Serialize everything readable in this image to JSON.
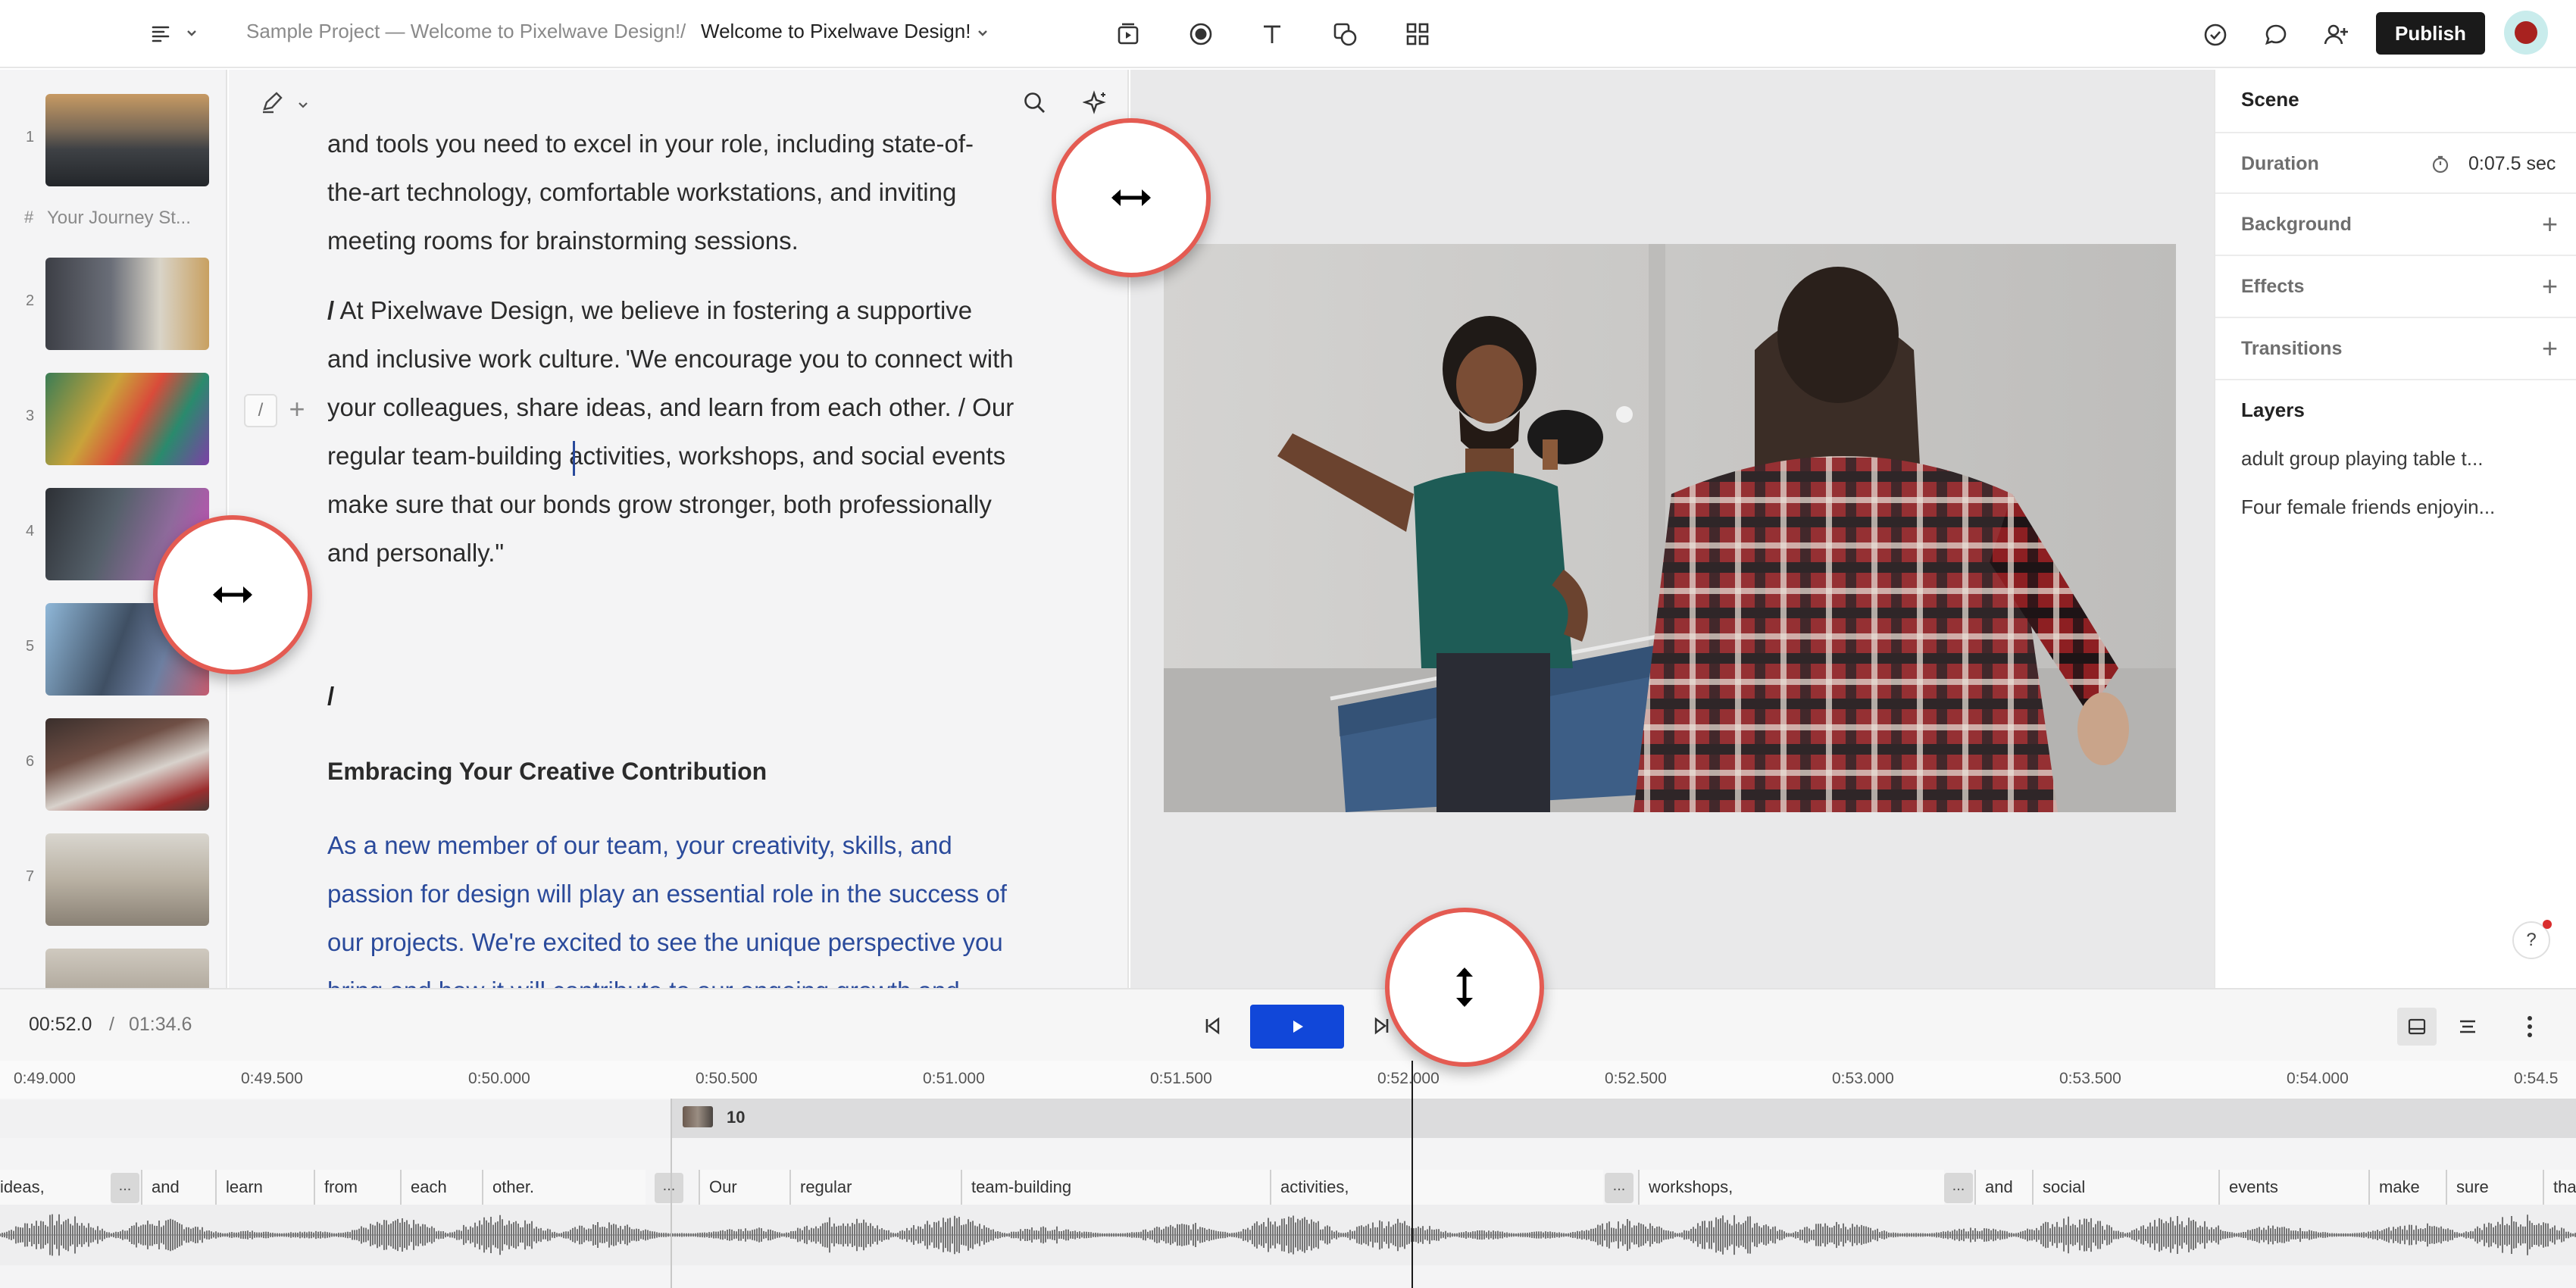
{
  "header": {
    "project": "Sample Project — Welcome to Pixelwave Design!",
    "separator": "/",
    "doc_title": "Welcome to Pixelwave Design!",
    "publish_label": "Publish",
    "icons": [
      "menu-icon",
      "chevron-down-icon",
      "preview-icon",
      "record-icon",
      "text-icon",
      "shapes-icon",
      "grid-icon",
      "check-circle-icon",
      "comment-icon",
      "add-user-icon"
    ]
  },
  "sidebar": {
    "section_marker": "#",
    "section_label": "Your Journey St...",
    "slides": [
      {
        "number": "1"
      },
      {
        "number": "2"
      },
      {
        "number": "3"
      },
      {
        "number": "4"
      },
      {
        "number": "5"
      },
      {
        "number": "6"
      },
      {
        "number": "7"
      }
    ]
  },
  "editor": {
    "para1_lines": [
      "and tools you need to excel in your role, including state-of-",
      "the-art technology, comfortable workstations, and inviting",
      "meeting rooms for brainstorming sessions."
    ],
    "para2_lines": [
      {
        "pre": "/",
        "text": " At Pixelwave Design, we believe in fostering a supportive"
      },
      {
        "pre": "",
        "text": "and inclusive work culture. 'We encourage you to connect with"
      },
      {
        "pre": "",
        "text": "your colleagues, share ideas, and learn from each other. / Our"
      },
      {
        "pre": "",
        "text": "regular team-building activities, workshops, and social events"
      },
      {
        "pre": "",
        "text": "make sure that our bonds grow stronger, both professionally"
      },
      {
        "pre": "",
        "text": "and personally.\""
      }
    ],
    "gutter_slash": "/",
    "gutter_plus": "+",
    "scene_slash": "/",
    "heading": "Embracing Your Creative Contribution",
    "para3_lines": [
      "As a new member of our team, your creativity, skills, and",
      "passion for design will play an essential role in the success of",
      "our projects. We're excited to see the unique perspective you",
      "bring and how it will contribute to our ongoing growth and"
    ],
    "link_color": "#2a4a9b"
  },
  "properties": {
    "title": "Scene",
    "duration_label": "Duration",
    "duration_value": "0:07.5 sec",
    "background_label": "Background",
    "effects_label": "Effects",
    "transitions_label": "Transitions",
    "layers_title": "Layers",
    "layers": [
      "adult group playing table t...",
      "Four female friends enjoyin..."
    ],
    "help_label": "?"
  },
  "player": {
    "current_time": "00:52.0",
    "separator": "/",
    "total_time": "01:34.6",
    "play_color": "#1147d9"
  },
  "timeline": {
    "ticks": [
      "0:49.000",
      "0:49.500",
      "0:50.000",
      "0:50.500",
      "0:51.000",
      "0:51.500",
      "0:52.000",
      "0:52.500",
      "0:53.000",
      "0:53.500",
      "0:54.000",
      "0:54.5"
    ],
    "scene_number": "10",
    "words": [
      "ideas,",
      "and",
      "learn",
      "from",
      "each",
      "other.",
      "Our",
      "regular",
      "team-building",
      "activities,",
      "workshops,",
      "and",
      "social",
      "events",
      "make",
      "sure",
      "tha"
    ],
    "gap_marker": "..."
  }
}
